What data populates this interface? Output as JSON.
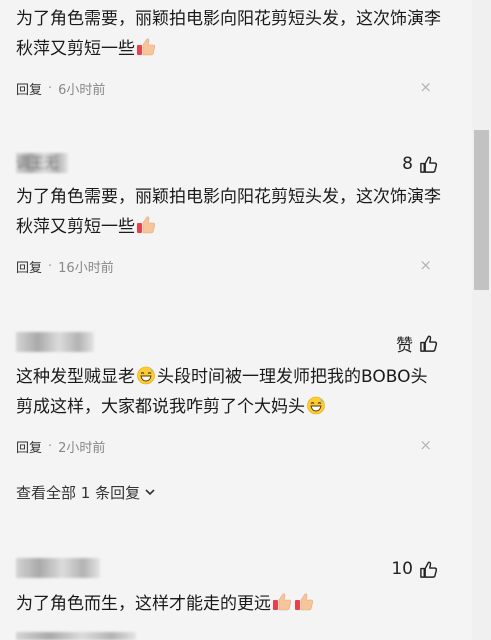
{
  "comments": [
    {
      "text": "为了角色需要，丽颖拍电影向阳花剪短头发，这次饰演李秋萍又剪短一些",
      "reply_label": "回复",
      "time": "6小时前"
    },
    {
      "user": "调王无",
      "likes": "8",
      "text": "为了角色需要，丽颖拍电影向阳花剪短头发，这次饰演李秋萍又剪短一些",
      "reply_label": "回复",
      "time": "16小时前"
    },
    {
      "likes": "赞",
      "text_a": "这种发型贼显老",
      "text_b": "头段时间被一理发师把我的BOBO头剪成这样，大家都说我咋剪了个大妈头",
      "reply_label": "回复",
      "time": "2小时前",
      "view_all": "查看全部 1 条回复"
    },
    {
      "likes": "10",
      "text": "为了角色而生，这样才能走的更远"
    }
  ],
  "icons": {
    "like": "thumbs-up-outline-icon",
    "clap": "thumbs-up-emoji-icon",
    "grin": "grinning-sweat-emoji-icon",
    "close": "close-icon",
    "expand": "chevron-down-icon"
  },
  "colors": {
    "background": "#f4f4f4",
    "text": "#1a1a1a",
    "meta": "#888888",
    "close": "#b5b5b5"
  },
  "close_glyph": "×"
}
